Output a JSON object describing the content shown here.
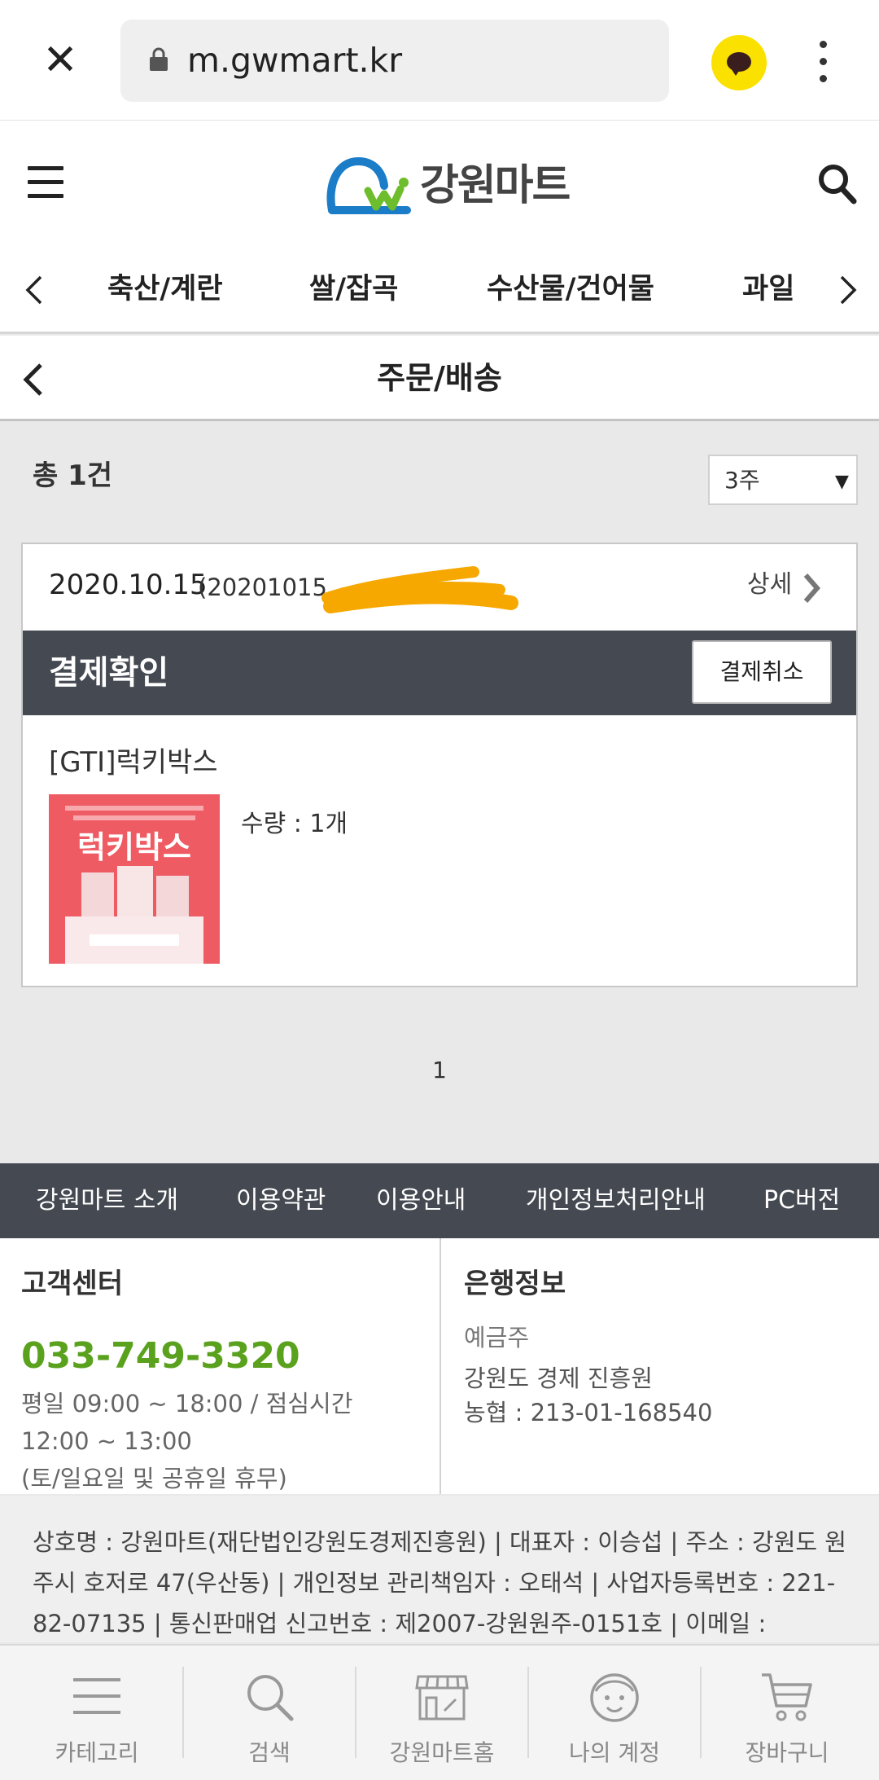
{
  "browser": {
    "url": "m.gwmart.kr",
    "close_icon": "close-icon",
    "kakao_color": "#fae100"
  },
  "header": {
    "logo_text": "강원마트",
    "logo_blue": "#1b7cc7",
    "logo_green": "#6dbd2c"
  },
  "categories": {
    "items": [
      "축산/계란",
      "쌀/잡곡",
      "수산물/건어물",
      "과일"
    ]
  },
  "page": {
    "title": "주문/배송"
  },
  "orders": {
    "total_label": "총 1건",
    "period": "3주",
    "date": "2020.10.15",
    "order_no": "(20201015",
    "detail_label": "상세",
    "status": "결제확인",
    "cancel_label": "결제취소",
    "product_name": "[GTI]럭키박스",
    "product_image_text": "럭키박스",
    "quantity": "수량 : 1개",
    "page_number": "1"
  },
  "footer_nav": [
    "강원마트 소개",
    "이용약관",
    "이용안내",
    "개인정보처리안내",
    "PC버전"
  ],
  "customer_center": {
    "title": "고객센터",
    "phone": "033-749-3320",
    "hours": "평일 09:00 ~ 18:00 / 점심시간 12:00 ~ 13:00",
    "holidays": "(토/일요일 및 공휴일 휴무)"
  },
  "bank": {
    "title": "은행정보",
    "holder_label": "예금주",
    "holder": "강원도 경제 진흥원",
    "account": "농협 : 213-01-168540"
  },
  "company": {
    "info": "상호명 : 강원마트(재단법인강원도경제진흥원) | 대표자 : 이승섭 | 주소 : 강원도 원주시 호저로 47(우산동) | 개인정보 관리책임자 : 오태석 | 사업자등록번호 : 221-82-07135 | 통신판매업 신고번호 : 제2007-강원원주-0151호 | 이메일 :"
  },
  "bottom_tabs": [
    {
      "label": "카테고리",
      "icon": "menu-lines-icon"
    },
    {
      "label": "검색",
      "icon": "search-icon"
    },
    {
      "label": "강원마트홈",
      "icon": "store-icon"
    },
    {
      "label": "나의 계정",
      "icon": "face-icon"
    },
    {
      "label": "장바구니",
      "icon": "cart-icon"
    }
  ]
}
